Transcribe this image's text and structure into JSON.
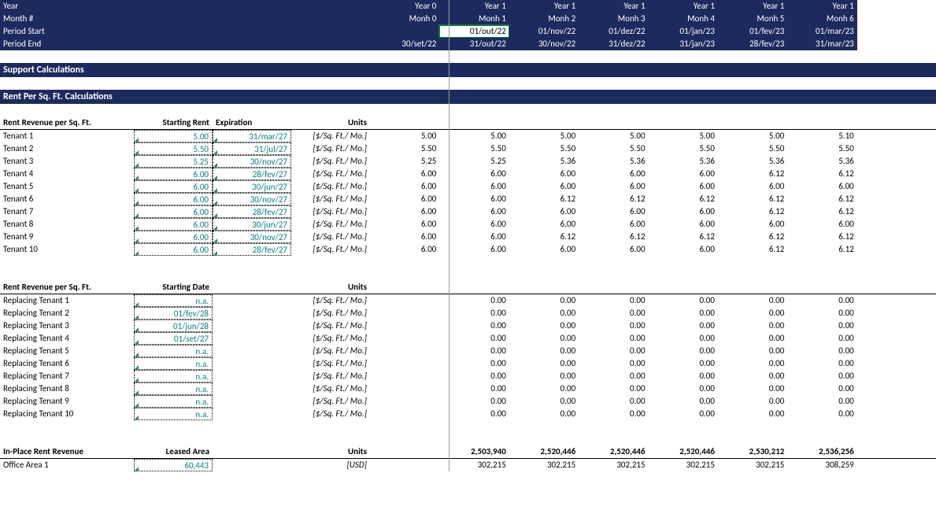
{
  "header": {
    "labels": [
      "Year",
      "Month #",
      "Period Start",
      "Period End"
    ],
    "year": [
      "Year 0",
      "Year 1",
      "Year 1",
      "Year 1",
      "Year 1",
      "Year 1",
      "Year 1"
    ],
    "month": [
      "Monh 0",
      "Monh 1",
      "Monh 2",
      "Monh 3",
      "Monh 4",
      "Monh 5",
      "Monh 6"
    ],
    "pstart": [
      "",
      "01/out/22",
      "01/nov/22",
      "01/dez/22",
      "01/jan/23",
      "01/fev/23",
      "01/mar/23"
    ],
    "pend": [
      "30/set/22",
      "31/out/22",
      "30/nov/22",
      "31/dez/22",
      "31/jan/23",
      "28/fev/23",
      "31/mar/23"
    ]
  },
  "sections": {
    "support": "Support Calculations",
    "rentcalc": "Rent Per Sq. Ft. Calculations"
  },
  "block1": {
    "title": "Rent Revenue per Sq. Ft.",
    "col1": "Starting Rent",
    "col2": "Expiration",
    "col3": "Units",
    "unit": "[$/Sq. Ft./ Mo.]",
    "rows": [
      {
        "name": "Tenant 1",
        "rent": "5.00",
        "exp": "31/mar/27",
        "v": [
          "5.00",
          "5.00",
          "5.00",
          "5.00",
          "5.00",
          "5.00",
          "5.10"
        ]
      },
      {
        "name": "Tenant 2",
        "rent": "5.50",
        "exp": "31/jul/27",
        "v": [
          "5.50",
          "5.50",
          "5.50",
          "5.50",
          "5.50",
          "5.50",
          "5.50"
        ]
      },
      {
        "name": "Tenant 3",
        "rent": "5.25",
        "exp": "30/nov/27",
        "v": [
          "5.25",
          "5.25",
          "5.36",
          "5.36",
          "5.36",
          "5.36",
          "5.36"
        ]
      },
      {
        "name": "Tenant 4",
        "rent": "6.00",
        "exp": "28/fev/27",
        "v": [
          "6.00",
          "6.00",
          "6.00",
          "6.00",
          "6.00",
          "6.12",
          "6.12"
        ]
      },
      {
        "name": "Tenant 5",
        "rent": "6.00",
        "exp": "30/jun/27",
        "v": [
          "6.00",
          "6.00",
          "6.00",
          "6.00",
          "6.00",
          "6.00",
          "6.00"
        ]
      },
      {
        "name": "Tenant 6",
        "rent": "6.00",
        "exp": "30/nov/27",
        "v": [
          "6.00",
          "6.00",
          "6.12",
          "6.12",
          "6.12",
          "6.12",
          "6.12"
        ]
      },
      {
        "name": "Tenant 7",
        "rent": "6.00",
        "exp": "28/fev/27",
        "v": [
          "6.00",
          "6.00",
          "6.00",
          "6.00",
          "6.00",
          "6.12",
          "6.12"
        ]
      },
      {
        "name": "Tenant 8",
        "rent": "6.00",
        "exp": "30/jun/27",
        "v": [
          "6.00",
          "6.00",
          "6.00",
          "6.00",
          "6.00",
          "6.00",
          "6.00"
        ]
      },
      {
        "name": "Tenant 9",
        "rent": "6.00",
        "exp": "30/nov/27",
        "v": [
          "6.00",
          "6.00",
          "6.12",
          "6.12",
          "6.12",
          "6.12",
          "6.12"
        ]
      },
      {
        "name": "Tenant 10",
        "rent": "6.00",
        "exp": "28/fev/27",
        "v": [
          "6.00",
          "6.00",
          "6.00",
          "6.00",
          "6.00",
          "6.12",
          "6.12"
        ]
      }
    ]
  },
  "block2": {
    "title": "Rent Revenue per Sq. Ft.",
    "col1": "Starting Date",
    "col3": "Units",
    "unit": "[$/Sq. Ft./ Mo.]",
    "rows": [
      {
        "name": "Replacing Tenant 1",
        "date": "n.a.",
        "v": [
          "",
          "0.00",
          "0.00",
          "0.00",
          "0.00",
          "0.00",
          "0.00"
        ]
      },
      {
        "name": "Replacing Tenant 2",
        "date": "01/fev/28",
        "v": [
          "",
          "0.00",
          "0.00",
          "0.00",
          "0.00",
          "0.00",
          "0.00"
        ]
      },
      {
        "name": "Replacing Tenant 3",
        "date": "01/jun/28",
        "v": [
          "",
          "0.00",
          "0.00",
          "0.00",
          "0.00",
          "0.00",
          "0.00"
        ]
      },
      {
        "name": "Replacing Tenant 4",
        "date": "01/set/27",
        "v": [
          "",
          "0.00",
          "0.00",
          "0.00",
          "0.00",
          "0.00",
          "0.00"
        ]
      },
      {
        "name": "Replacing Tenant 5",
        "date": "n.a.",
        "v": [
          "",
          "0.00",
          "0.00",
          "0.00",
          "0.00",
          "0.00",
          "0.00"
        ]
      },
      {
        "name": "Replacing Tenant 6",
        "date": "n.a.",
        "v": [
          "",
          "0.00",
          "0.00",
          "0.00",
          "0.00",
          "0.00",
          "0.00"
        ]
      },
      {
        "name": "Replacing Tenant 7",
        "date": "n.a.",
        "v": [
          "",
          "0.00",
          "0.00",
          "0.00",
          "0.00",
          "0.00",
          "0.00"
        ]
      },
      {
        "name": "Replacing Tenant 8",
        "date": "n.a.",
        "v": [
          "",
          "0.00",
          "0.00",
          "0.00",
          "0.00",
          "0.00",
          "0.00"
        ]
      },
      {
        "name": "Replacing Tenant 9",
        "date": "n.a.",
        "v": [
          "",
          "0.00",
          "0.00",
          "0.00",
          "0.00",
          "0.00",
          "0.00"
        ]
      },
      {
        "name": "Replacing Tenant 10",
        "date": "n.a.",
        "v": [
          "",
          "0.00",
          "0.00",
          "0.00",
          "0.00",
          "0.00",
          "0.00"
        ]
      }
    ]
  },
  "block3": {
    "title": "In-Place Rent Revenue",
    "col1": "Leased Area",
    "col3": "Units",
    "totals": [
      "",
      "2,503,940",
      "2,520,446",
      "2,520,446",
      "2,520,446",
      "2,530,212",
      "2,536,256"
    ],
    "row": {
      "name": "Office Area 1",
      "area": "60,443",
      "unit": "[USD]",
      "v": [
        "",
        "302,215",
        "302,215",
        "302,215",
        "302,215",
        "302,215",
        "308,259"
      ]
    }
  }
}
